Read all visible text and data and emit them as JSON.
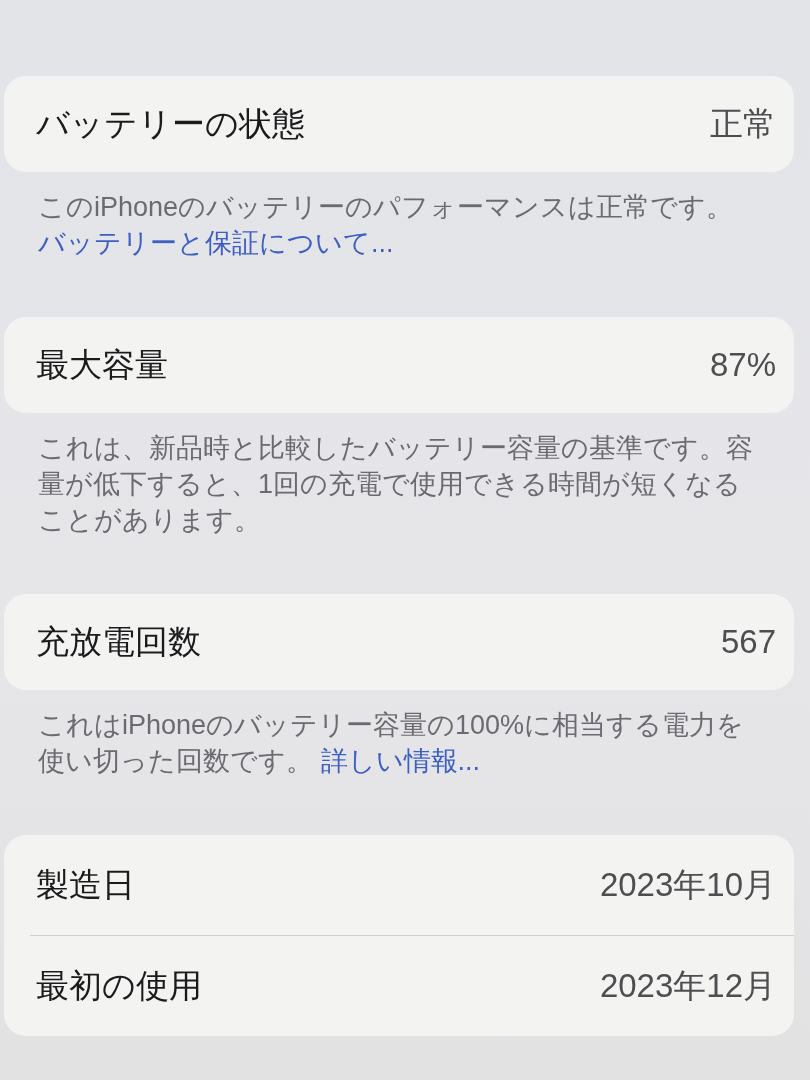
{
  "sections": [
    {
      "rows": [
        {
          "label": "バッテリーの状態",
          "value": "正常"
        }
      ],
      "footer": {
        "text": "このiPhoneのバッテリーのパフォーマンスは正常です。",
        "link": "バッテリーと保証について..."
      }
    },
    {
      "rows": [
        {
          "label": "最大容量",
          "value": "87%"
        }
      ],
      "footer": {
        "text": "これは、新品時と比較したバッテリー容量の基準です。容量が低下すると、1回の充電で使用できる時間が短くなることがあります。"
      }
    },
    {
      "rows": [
        {
          "label": "充放電回数",
          "value": "567"
        }
      ],
      "footer": {
        "text": "これはiPhoneのバッテリー容量の100%に相当する電力を使い切った回数です。",
        "link": "詳しい情報..."
      }
    },
    {
      "rows": [
        {
          "label": "製造日",
          "value": "2023年10月"
        },
        {
          "label": "最初の使用",
          "value": "2023年12月"
        }
      ]
    }
  ]
}
